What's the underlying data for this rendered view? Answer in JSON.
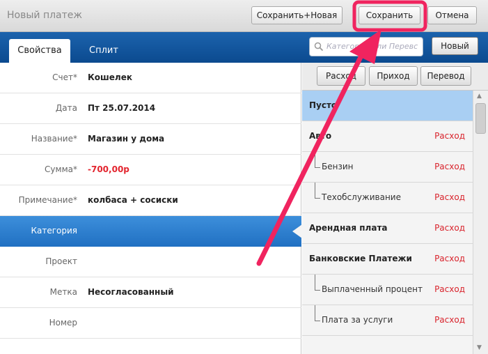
{
  "window": {
    "title": "Новый платеж"
  },
  "toolbar": {
    "save_new_label": "Сохранить+Новая",
    "save_label": "Сохранить",
    "cancel_label": "Отмена"
  },
  "tabs": [
    {
      "label": "Свойства",
      "active": true
    },
    {
      "label": "Сплит",
      "active": false
    }
  ],
  "search": {
    "placeholder": "Категории или Перевс"
  },
  "new_button_label": "Новый",
  "filters": [
    "Расход",
    "Приход",
    "Перевод"
  ],
  "fields": [
    {
      "label": "Счет*",
      "value": "Кошелек"
    },
    {
      "label": "Дата",
      "value": "Пт 25.07.2014"
    },
    {
      "label": "Название*",
      "value": "Магазин у дома"
    },
    {
      "label": "Сумма*",
      "value": "-700,00р"
    },
    {
      "label": "Примечание*",
      "value": "колбаса + сосиски"
    },
    {
      "label": "Категория",
      "value": ""
    },
    {
      "label": "Проект",
      "value": ""
    },
    {
      "label": "Метка",
      "value": "Несогласованный"
    },
    {
      "label": "Номер",
      "value": ""
    }
  ],
  "categories": [
    {
      "name": "Пусто",
      "type": ""
    },
    {
      "name": "Авто",
      "type": "Расход"
    },
    {
      "name": "Бензин",
      "type": "Расход"
    },
    {
      "name": "Техобслуживание",
      "type": "Расход"
    },
    {
      "name": "Арендная плата",
      "type": "Расход"
    },
    {
      "name": "Банковские Платежи",
      "type": "Расход"
    },
    {
      "name": "Выплаченный процент",
      "type": "Расход"
    },
    {
      "name": "Плата за услуги",
      "type": "Расход"
    }
  ],
  "colors": {
    "accent_blue": "#1a5fa8",
    "selected_row": "#2f80d0",
    "expense_red": "#d9232c",
    "highlight_pink": "#f0245f"
  }
}
